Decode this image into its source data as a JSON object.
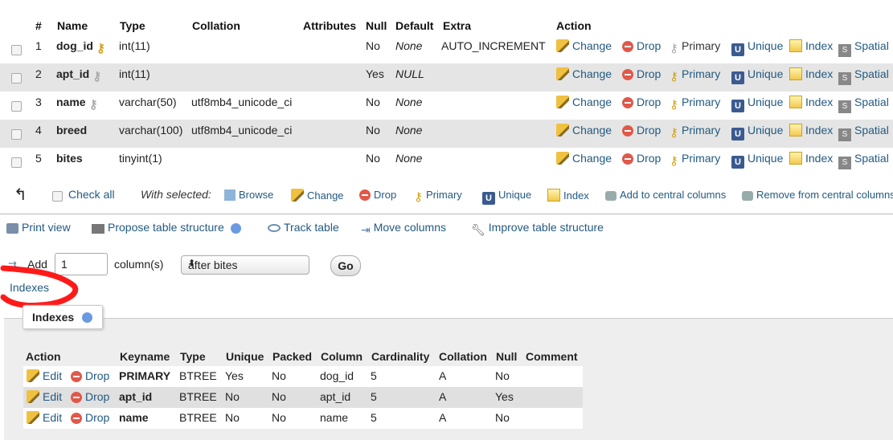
{
  "columns_table": {
    "headers": [
      "#",
      "Name",
      "Type",
      "Collation",
      "Attributes",
      "Null",
      "Default",
      "Extra",
      "Action"
    ],
    "rows": [
      {
        "num": "1",
        "name": "dog_id",
        "type": "int(11)",
        "collation": "",
        "null": "No",
        "default": "None",
        "extra": "AUTO_INCREMENT"
      },
      {
        "num": "2",
        "name": "apt_id",
        "type": "int(11)",
        "collation": "",
        "null": "Yes",
        "default": "NULL",
        "extra": ""
      },
      {
        "num": "3",
        "name": "name",
        "type": "varchar(50)",
        "collation": "utf8mb4_unicode_ci",
        "null": "No",
        "default": "None",
        "extra": ""
      },
      {
        "num": "4",
        "name": "breed",
        "type": "varchar(100)",
        "collation": "utf8mb4_unicode_ci",
        "null": "No",
        "default": "None",
        "extra": ""
      },
      {
        "num": "5",
        "name": "bites",
        "type": "tinyint(1)",
        "collation": "",
        "null": "No",
        "default": "None",
        "extra": ""
      }
    ],
    "actions": {
      "change": "Change",
      "drop": "Drop",
      "primary": "Primary",
      "unique": "Unique",
      "index": "Index",
      "spatial": "Spatial"
    }
  },
  "bulk": {
    "check_all": "Check all",
    "with_selected": "With selected:",
    "browse": "Browse",
    "change": "Change",
    "drop": "Drop",
    "primary": "Primary",
    "unique": "Unique",
    "index": "Index",
    "add_central": "Add to central columns",
    "remove_central": "Remove from central columns"
  },
  "links": {
    "print_view": "Print view",
    "propose": "Propose table structure",
    "track": "Track table",
    "move": "Move columns",
    "improve": "Improve table structure"
  },
  "add_column": {
    "label": "Add",
    "count": "1",
    "unit": "column(s)",
    "position": "after bites",
    "go": "Go"
  },
  "indexes_link": "Indexes",
  "indexes_panel": {
    "legend": "Indexes",
    "headers": [
      "Action",
      "Keyname",
      "Type",
      "Unique",
      "Packed",
      "Column",
      "Cardinality",
      "Collation",
      "Null",
      "Comment"
    ],
    "edit": "Edit",
    "drop": "Drop",
    "rows": [
      {
        "keyname": "PRIMARY",
        "type": "BTREE",
        "unique": "Yes",
        "packed": "No",
        "column": "dog_id",
        "cardinality": "5",
        "collation": "A",
        "null": "No",
        "comment": ""
      },
      {
        "keyname": "apt_id",
        "type": "BTREE",
        "unique": "No",
        "packed": "No",
        "column": "apt_id",
        "cardinality": "5",
        "collation": "A",
        "null": "Yes",
        "comment": ""
      },
      {
        "keyname": "name",
        "type": "BTREE",
        "unique": "No",
        "packed": "No",
        "column": "name",
        "cardinality": "5",
        "collation": "A",
        "null": "No",
        "comment": ""
      }
    ]
  },
  "colors": {
    "link": "#235a81",
    "row_alt": "#e5e5e5",
    "panel": "#eeeeee",
    "annotation": "#ff1a1a"
  }
}
